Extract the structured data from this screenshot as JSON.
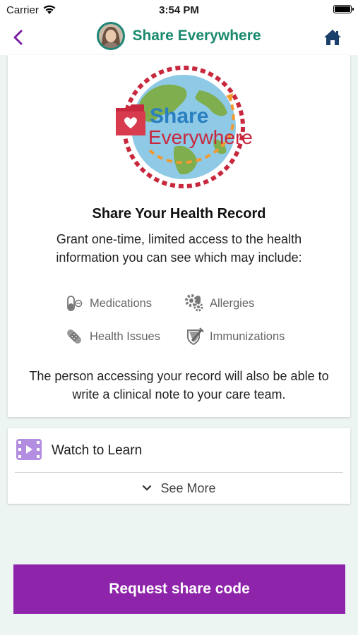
{
  "status_bar": {
    "carrier": "Carrier",
    "time": "3:54 PM"
  },
  "nav": {
    "title": "Share Everywhere"
  },
  "logo": {
    "line1": "Share",
    "line2": "Everywhere"
  },
  "card": {
    "heading": "Share Your Health Record",
    "description": "Grant one-time, limited access to the health information you can see which may include:",
    "features": [
      {
        "label": "Medications",
        "icon": "pill-icon"
      },
      {
        "label": "Allergies",
        "icon": "allergy-icon"
      },
      {
        "label": "Health Issues",
        "icon": "bandage-icon"
      },
      {
        "label": "Immunizations",
        "icon": "syringe-shield-icon"
      }
    ],
    "footer": "The person accessing your record will also be able to write a clinical note to your care team."
  },
  "learn": {
    "watch_label": "Watch to Learn",
    "see_more_label": "See More"
  },
  "action": {
    "request_label": "Request share code"
  },
  "colors": {
    "accent_purple": "#8e24aa",
    "title_teal": "#1a8a6f",
    "nav_purple": "#7b1fa2",
    "home_navy": "#1b3f6b"
  }
}
